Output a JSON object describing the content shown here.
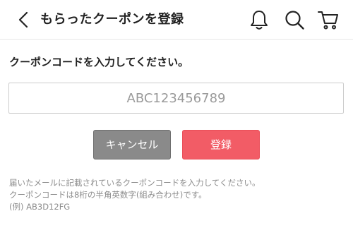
{
  "header": {
    "title": "もらったクーポンを登録",
    "icons": [
      "chevron-left-icon",
      "bell-icon",
      "search-icon",
      "cart-icon"
    ]
  },
  "form": {
    "instruction": "クーポンコードを入力してください。",
    "code_input": {
      "value": "",
      "placeholder": "ABC123456789"
    },
    "cancel_label": "キャンセル",
    "register_label": "登録"
  },
  "notes": {
    "line1": "届いたメールに記載されているクーポンコードを入力してください。",
    "line2": "クーポンコードは8桁の半角英数字(組み合わせ)です。",
    "line3": "(例) AB3D12FG"
  },
  "colors": {
    "register_button": "#f25c66",
    "cancel_button": "#8a8a8a",
    "note_text": "#8c8c8c"
  }
}
